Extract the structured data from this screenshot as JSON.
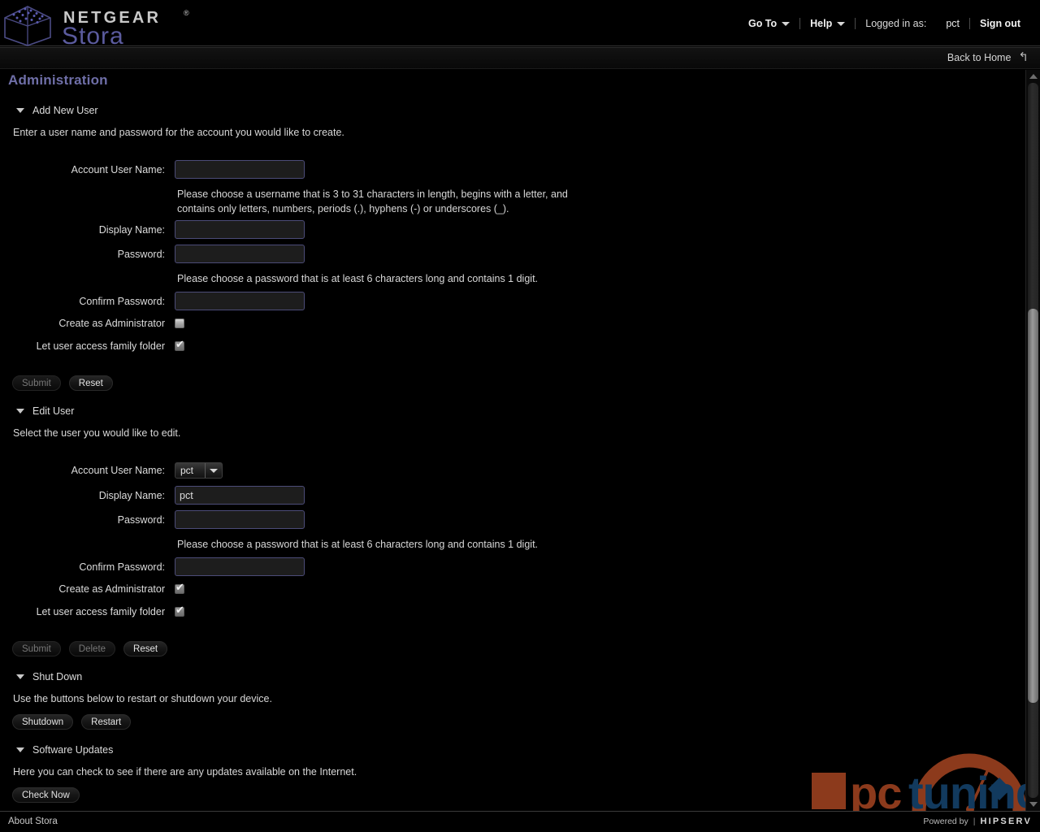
{
  "header": {
    "brand_top": "NETGEAR",
    "brand_tm": "®",
    "brand_bottom": "Stora",
    "nav": {
      "goto": "Go To",
      "help": "Help",
      "logged_in_label": "Logged in as:",
      "logged_in_user": "pct",
      "sign_out": "Sign out"
    },
    "back_to_home": "Back to Home",
    "back_icon": "↰"
  },
  "page": {
    "title": "Administration"
  },
  "sections": {
    "add_new_user": {
      "heading": "Add New User",
      "description": "Enter a user name and password for the account you would like to create.",
      "fields": {
        "account_user_name_label": "Account User Name:",
        "account_user_name_value": "",
        "username_hint": "Please choose a username that is 3 to 31 characters in length, begins with a letter, and contains only letters, numbers, periods (.), hyphens (-) or underscores (_).",
        "display_name_label": "Display Name:",
        "display_name_value": "",
        "password_label": "Password:",
        "password_value": "",
        "password_hint": "Please choose a password that is at least 6 characters long and contains 1 digit.",
        "confirm_password_label": "Confirm Password:",
        "confirm_password_value": "",
        "create_admin_label": "Create as Administrator",
        "create_admin_checked": false,
        "family_folder_label": "Let user access family folder",
        "family_folder_checked": true
      },
      "buttons": {
        "submit": "Submit",
        "submit_disabled": true,
        "reset": "Reset"
      }
    },
    "edit_user": {
      "heading": "Edit User",
      "description": "Select the user you would like to edit.",
      "fields": {
        "account_user_name_label": "Account User Name:",
        "account_user_name_selected": "pct",
        "display_name_label": "Display Name:",
        "display_name_value": "pct",
        "password_label": "Password:",
        "password_value": "",
        "password_hint": "Please choose a password that is at least 6 characters long and contains 1 digit.",
        "confirm_password_label": "Confirm Password:",
        "confirm_password_value": "",
        "create_admin_label": "Create as Administrator",
        "create_admin_checked": true,
        "family_folder_label": "Let user access family folder",
        "family_folder_checked": true
      },
      "buttons": {
        "submit": "Submit",
        "submit_disabled": true,
        "delete": "Delete",
        "delete_disabled": true,
        "reset": "Reset"
      }
    },
    "shut_down": {
      "heading": "Shut Down",
      "description": "Use the buttons below to restart or shutdown your device.",
      "buttons": {
        "shutdown": "Shutdown",
        "restart": "Restart"
      }
    },
    "software_updates": {
      "heading": "Software Updates",
      "description": "Here you can check to see if there are any updates available on the Internet.",
      "buttons": {
        "check_now": "Check Now"
      }
    }
  },
  "footer": {
    "about": "About Stora",
    "powered_by": "Powered by",
    "separator": "|",
    "provider": "HIPSERV",
    "provider_tm": "™"
  },
  "watermark": {
    "text_pc": "pc",
    "text_tuning": "tuning"
  },
  "colors": {
    "accent_title": "#6f6fa8",
    "brand_stora": "#5b5b9e",
    "input_border": "#4c4c78",
    "background": "#000000",
    "watermark_rust": "#8c3a1c",
    "watermark_blue": "#123a5e"
  }
}
